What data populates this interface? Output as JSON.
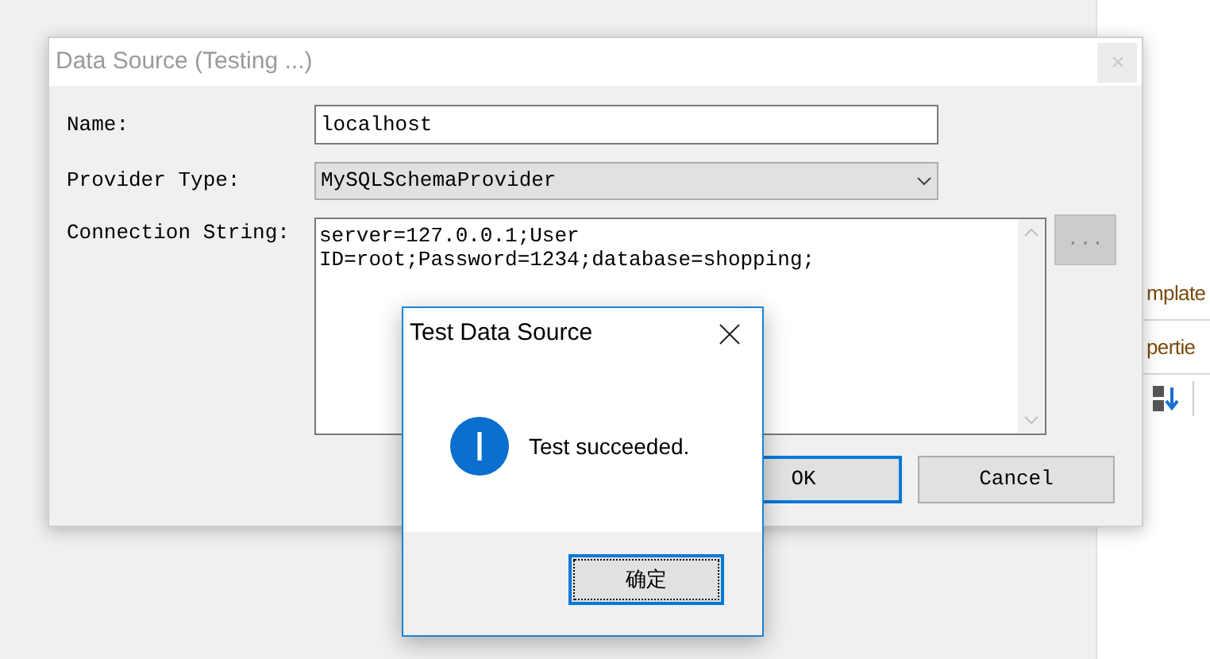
{
  "background_panel": {
    "tabs": [
      {
        "label": "mplate"
      },
      {
        "label": "pertie"
      }
    ]
  },
  "dialog": {
    "title": "Data Source (Testing ...)",
    "fields": [
      {
        "kind": "text",
        "label": "Name:",
        "value": "localhost"
      },
      {
        "kind": "select",
        "label": "Provider Type:",
        "value": "MySQLSchemaProvider"
      },
      {
        "kind": "multiline",
        "label": "Connection String:",
        "lines": [
          "server=127.0.0.1;User",
          "ID=root;Password=1234;database=shopping;"
        ],
        "button": "..."
      }
    ],
    "buttons": [
      {
        "label": "OK",
        "selected": true
      },
      {
        "label": "Cancel",
        "selected": false
      }
    ]
  },
  "message_box": {
    "title": "Test Data Source",
    "message": "Test succeeded.",
    "button": "确定"
  }
}
